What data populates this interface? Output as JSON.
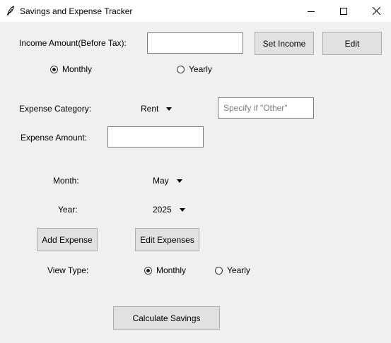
{
  "window": {
    "title": "Savings and Expense Tracker",
    "icon": "feather-icon",
    "controls": [
      "minimize-icon",
      "maximize-icon",
      "close-icon"
    ]
  },
  "income": {
    "label": "Income Amount(Before Tax):",
    "value": "",
    "set_button": "Set Income",
    "edit_button": "Edit",
    "period_options": [
      {
        "label": "Monthly",
        "checked": true
      },
      {
        "label": "Yearly",
        "checked": false
      }
    ]
  },
  "expense": {
    "category_label": "Expense Category:",
    "category_value": "Rent",
    "other_placeholder": "Specify if \"Other\"",
    "other_value": "",
    "amount_label": "Expense Amount:",
    "amount_value": "",
    "month_label": "Month:",
    "month_value": "May",
    "year_label": "Year:",
    "year_value": "2025",
    "add_button": "Add Expense",
    "edit_button": "Edit Expenses"
  },
  "view": {
    "label": "View Type:",
    "options": [
      {
        "label": "Monthly",
        "checked": true
      },
      {
        "label": "Yearly",
        "checked": false
      }
    ]
  },
  "calculate_button": "Calculate Savings"
}
